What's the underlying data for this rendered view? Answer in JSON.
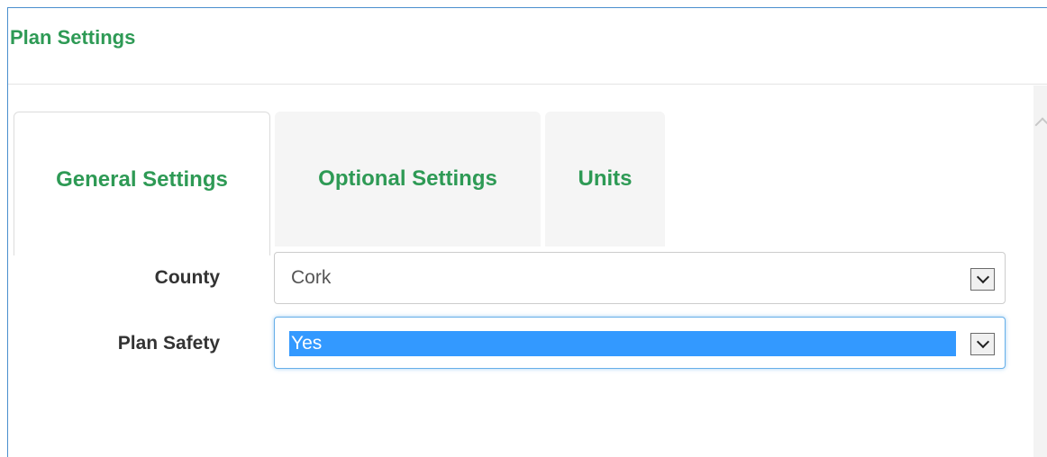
{
  "panel": {
    "title": "Plan Settings"
  },
  "tabs": [
    {
      "label": "General Settings",
      "active": true
    },
    {
      "label": "Optional Settings",
      "active": false
    },
    {
      "label": "Units",
      "active": false
    }
  ],
  "fields": {
    "county": {
      "label": "County",
      "value": "Cork"
    },
    "plan_safety": {
      "label": "Plan Safety",
      "value": "Yes"
    }
  },
  "colors": {
    "accent": "#2e9a55",
    "panel_border": "#4a8fce",
    "selection": "#3399ff",
    "focus": "#66afe9"
  }
}
